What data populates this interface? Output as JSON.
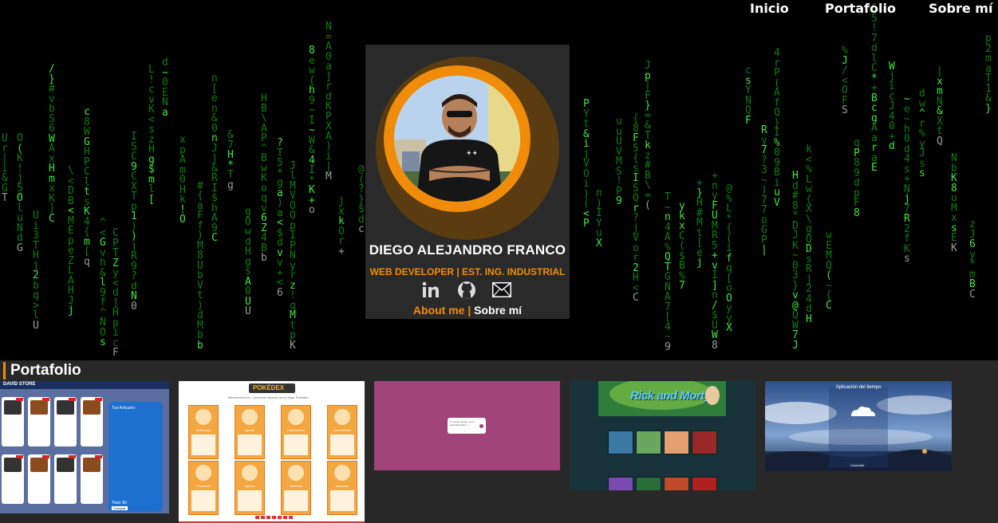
{
  "nav": {
    "items": [
      {
        "label": "Inicio"
      },
      {
        "label": "Portafolio"
      },
      {
        "label": "Sobre mí"
      }
    ]
  },
  "profile": {
    "name": "DIEGO ALEJANDRO FRANCO",
    "role": "WEB DEVELOPER | EST. ING. INDUSTRIAL",
    "about_en": "About me",
    "about_sep": " | ",
    "about_es": "Sobre mí",
    "socials": [
      {
        "icon": "linkedin-icon"
      },
      {
        "icon": "github-icon"
      },
      {
        "icon": "mail-icon"
      }
    ]
  },
  "portfolio": {
    "title": "Portafolio",
    "projects": [
      {
        "store_name": "DAVID STORE",
        "cart_label": "Tus Artículos:",
        "total_label": "Total: $0",
        "buy_label": "Comprar"
      },
      {
        "title": "POKÉDEX",
        "subtitle": "Bienvenido a tu ...pokemón favorito en la mejor Pokedex",
        "pokemon": [
          "Bulbasaur",
          "Ivysaur",
          "Charmander",
          "Charmeleon",
          "Charizard",
          "Squirtle",
          "Wartortle",
          "Blastoise"
        ]
      },
      {
        "message": "Lo siento mucho, ya no está disponible :("
      },
      {
        "title": "Rick and Morty"
      },
      {
        "title": "Aplicación del tiempo",
        "button": "Consultar"
      }
    ]
  },
  "colors": {
    "accent": "#f08c0a",
    "matrix_green": "#0b7d0b",
    "background": "#000000",
    "portfolio_bg": "#282828"
  }
}
